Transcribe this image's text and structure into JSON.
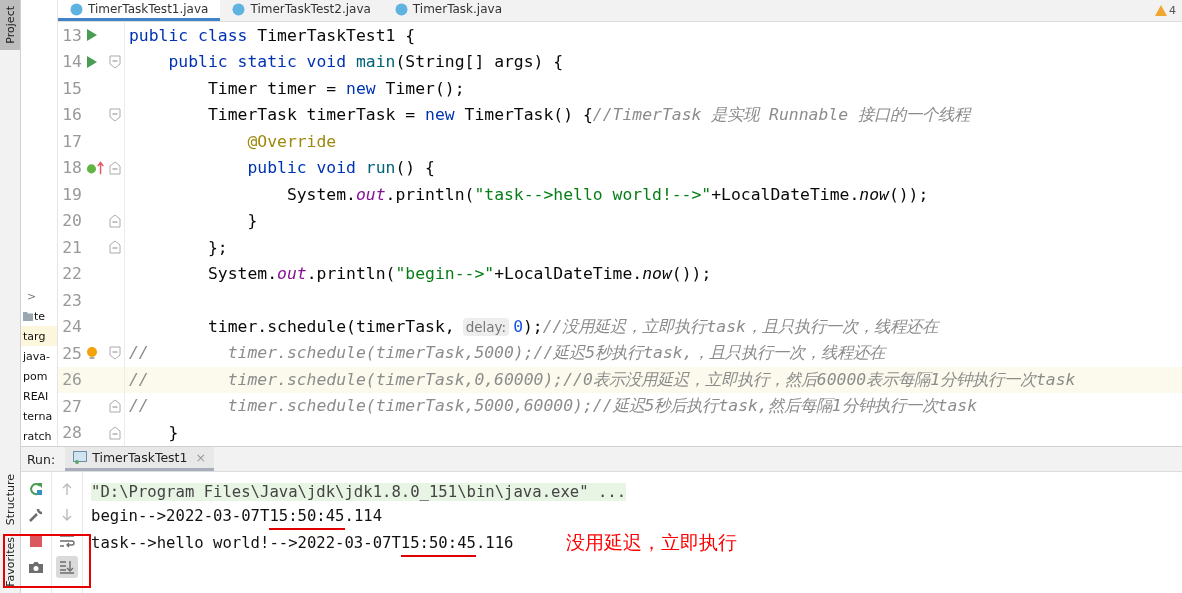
{
  "tool_strip": {
    "top": [
      {
        "label": "Project",
        "selected": true
      }
    ],
    "bottom": [
      {
        "label": "Structure",
        "selected": false
      },
      {
        "label": "Favorites",
        "selected": false
      }
    ]
  },
  "editor_tabs": [
    {
      "label": "TimerTaskTest1.java",
      "selected": true
    },
    {
      "label": "TimerTaskTest2.java",
      "selected": false
    },
    {
      "label": "TimerTask.java",
      "selected": false
    }
  ],
  "inspections": {
    "warnings": "4"
  },
  "project_tree": [
    {
      "kind": "chevron",
      "text": ">",
      "selected": false
    },
    {
      "kind": "folder",
      "text": "te",
      "selected": false
    },
    {
      "kind": "file",
      "text": "targ",
      "selected": true
    },
    {
      "kind": "file",
      "text": "java-",
      "selected": false
    },
    {
      "kind": "file",
      "text": "pom",
      "selected": false
    },
    {
      "kind": "file",
      "text": "REAI",
      "selected": false
    },
    {
      "kind": "file",
      "text": "terna",
      "selected": false
    },
    {
      "kind": "file",
      "text": "ratch",
      "selected": false
    }
  ],
  "code_lines": [
    {
      "number": "13",
      "gutter": {
        "kind": "run"
      },
      "current": false,
      "tokens": [
        {
          "kind": "kw",
          "text": "public class "
        },
        {
          "kind": "plain",
          "text": "TimerTaskTest1 {"
        }
      ]
    },
    {
      "number": "14",
      "gutter": {
        "kind": "run"
      },
      "fold": {
        "kind": "open"
      },
      "current": false,
      "tokens": [
        {
          "kind": "kw",
          "text": "    public static void "
        },
        {
          "kind": "method",
          "text": "main"
        },
        {
          "kind": "plain",
          "text": "(String[] args) {"
        }
      ]
    },
    {
      "number": "15",
      "current": false,
      "tokens": [
        {
          "kind": "plain",
          "text": "        Timer timer = "
        },
        {
          "kind": "kw",
          "text": "new "
        },
        {
          "kind": "plain",
          "text": "Timer();"
        }
      ]
    },
    {
      "number": "16",
      "fold": {
        "kind": "open"
      },
      "current": false,
      "tokens": [
        {
          "kind": "plain",
          "text": "        TimerTask timerTask = "
        },
        {
          "kind": "kw",
          "text": "new "
        },
        {
          "kind": "plain",
          "text": "TimerTask() {"
        },
        {
          "kind": "comment",
          "text": "//TimerTask 是实现 Runnable 接口的一个线程"
        }
      ]
    },
    {
      "number": "17",
      "current": false,
      "tokens": [
        {
          "kind": "anno",
          "text": "            @Override"
        }
      ]
    },
    {
      "number": "18",
      "gutter": {
        "kind": "override"
      },
      "fold": {
        "kind": "close"
      },
      "current": false,
      "tokens": [
        {
          "kind": "kw",
          "text": "            public void "
        },
        {
          "kind": "method",
          "text": "run"
        },
        {
          "kind": "plain",
          "text": "() {"
        }
      ]
    },
    {
      "number": "19",
      "current": false,
      "tokens": [
        {
          "kind": "plain",
          "text": "                System."
        },
        {
          "kind": "field",
          "text": "out"
        },
        {
          "kind": "plain",
          "text": ".println("
        },
        {
          "kind": "str",
          "text": "\"task-->hello world!-->\""
        },
        {
          "kind": "plain",
          "text": "+LocalDateTime."
        },
        {
          "kind": "call",
          "text": "now"
        },
        {
          "kind": "plain",
          "text": "());"
        }
      ]
    },
    {
      "number": "20",
      "fold": {
        "kind": "close"
      },
      "current": false,
      "tokens": [
        {
          "kind": "plain",
          "text": "            }"
        }
      ]
    },
    {
      "number": "21",
      "fold": {
        "kind": "close"
      },
      "current": false,
      "tokens": [
        {
          "kind": "plain",
          "text": "        };"
        }
      ]
    },
    {
      "number": "22",
      "current": false,
      "tokens": [
        {
          "kind": "plain",
          "text": "        System."
        },
        {
          "kind": "field",
          "text": "out"
        },
        {
          "kind": "plain",
          "text": ".println("
        },
        {
          "kind": "str",
          "text": "\"begin-->\""
        },
        {
          "kind": "plain",
          "text": "+LocalDateTime."
        },
        {
          "kind": "call",
          "text": "now"
        },
        {
          "kind": "plain",
          "text": "());"
        }
      ]
    },
    {
      "number": "23",
      "current": false
    },
    {
      "number": "24",
      "current": false,
      "tokens": [
        {
          "kind": "plain",
          "text": "        timer.schedule(timerTask,"
        },
        {
          "kind": "hint",
          "text": "delay:"
        },
        {
          "kind": "num",
          "text": "0"
        },
        {
          "kind": "plain",
          "text": ");"
        },
        {
          "kind": "comment",
          "text": "//没用延迟，立即执行task，且只执行一次，线程还在"
        }
      ]
    },
    {
      "number": "25",
      "gutter": {
        "kind": "bulb"
      },
      "fold": {
        "kind": "open"
      },
      "current": false,
      "tokens": [
        {
          "kind": "comment",
          "text": "//        timer.schedule(timerTask,5000);//延迟5秒执行task,，且只执行一次，线程还在"
        }
      ]
    },
    {
      "number": "26",
      "current": true,
      "tokens": [
        {
          "kind": "comment",
          "text": "//        timer.schedule(timerTask,0,60000);//0表示没用延迟，立即执行，然后60000表示每隔1分钟执行一次task"
        }
      ]
    },
    {
      "number": "27",
      "fold": {
        "kind": "close"
      },
      "current": false,
      "tokens": [
        {
          "kind": "comment",
          "text": "//        timer.schedule(timerTask,5000,60000);//延迟5秒后执行task,然后每隔1分钟执行一次task"
        }
      ]
    },
    {
      "number": "28",
      "fold": {
        "kind": "close"
      },
      "current": false,
      "tokens": [
        {
          "kind": "plain",
          "text": "    }"
        }
      ]
    }
  ],
  "run_panel": {
    "label": "Run:",
    "tab": {
      "label": "TimerTaskTest1",
      "selected": true,
      "close": "×"
    },
    "toolbar_left": [
      {
        "kind": "rerun"
      },
      {
        "kind": "wrench"
      },
      {
        "kind": "stop"
      },
      {
        "kind": "camera"
      }
    ],
    "toolbar_right": [
      {
        "kind": "up",
        "disabled": true,
        "on": false
      },
      {
        "kind": "down",
        "disabled": true,
        "on": false
      },
      {
        "kind": "wrap",
        "disabled": false,
        "on": false
      },
      {
        "kind": "scroll-end",
        "disabled": false,
        "on": true
      }
    ],
    "console": [
      {
        "kind": "command",
        "parts": [
          {
            "text": "\"D:\\Program Files\\Java\\jdk\\jdk1.8.0_151\\bin\\java.exe\" ...",
            "marked": false
          }
        ]
      },
      {
        "kind": "output",
        "parts": [
          {
            "text": "begin-->2022-03-07T",
            "marked": false
          },
          {
            "text": "15:50:45",
            "marked": true
          },
          {
            "text": ".114",
            "marked": false
          }
        ]
      },
      {
        "kind": "output",
        "parts": [
          {
            "text": "task-->hello world!-->2022-03-07T",
            "marked": false
          },
          {
            "text": "15:50:45",
            "marked": true
          },
          {
            "text": ".116",
            "marked": false
          }
        ]
      }
    ],
    "annotation": {
      "text": "没用延迟，立即执行"
    }
  }
}
